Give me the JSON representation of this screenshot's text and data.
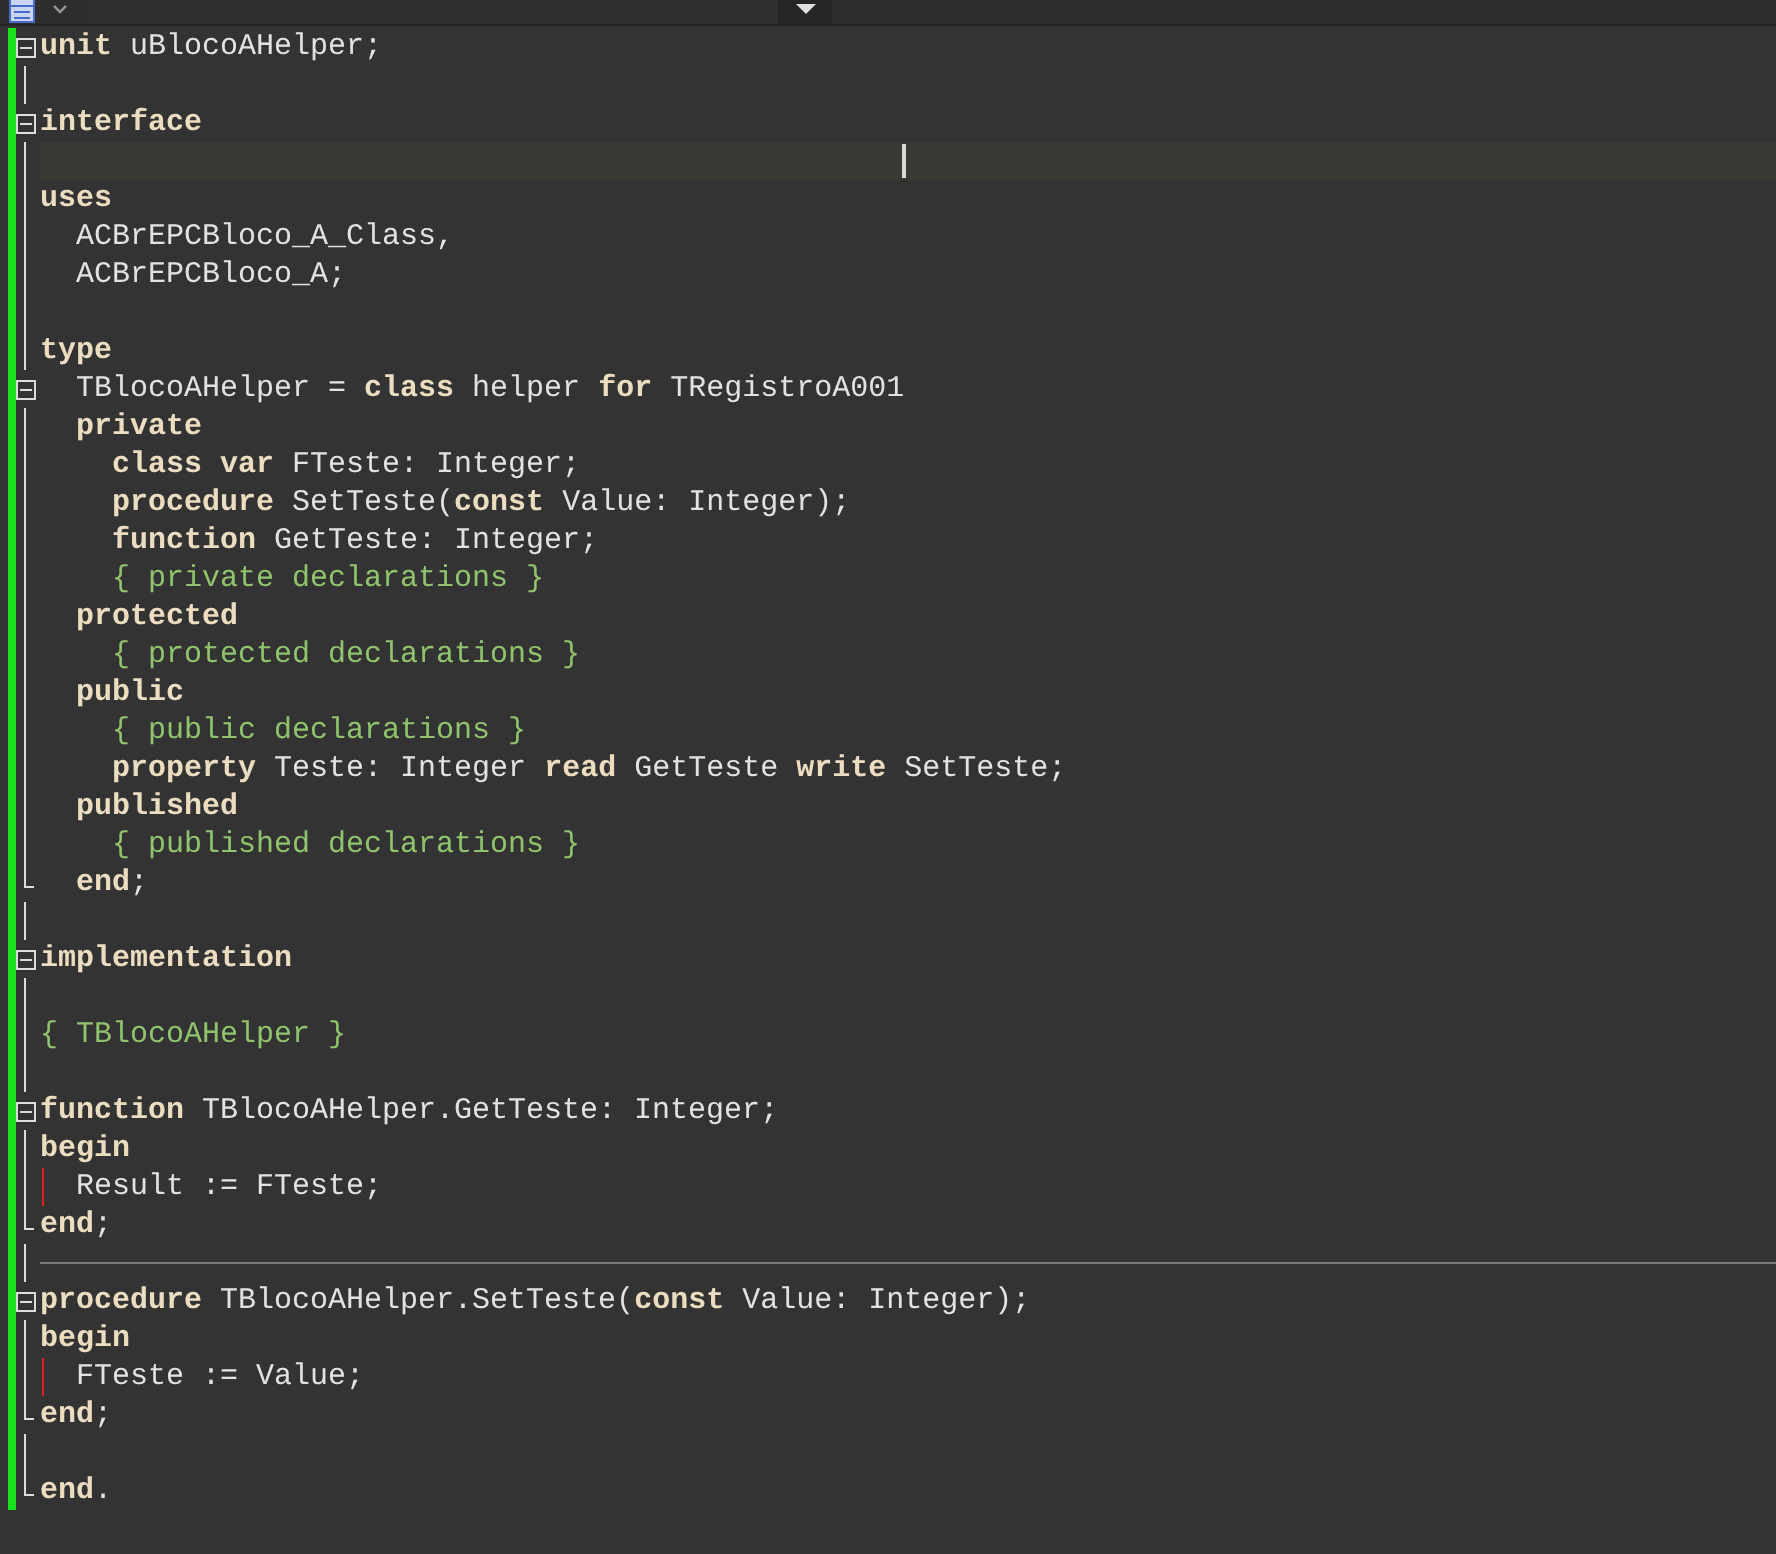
{
  "lines": [
    {
      "kind": "start",
      "current": false,
      "cursor": false,
      "guide": false,
      "separator": false,
      "segments": [
        {
          "kind": "keyword",
          "text": "unit"
        },
        {
          "kind": "plain",
          "text": " uBlocoAHelper;"
        }
      ]
    },
    {
      "kind": "line",
      "current": false,
      "cursor": false,
      "guide": false,
      "separator": false
    },
    {
      "kind": "start",
      "current": false,
      "cursor": false,
      "guide": false,
      "separator": false,
      "segments": [
        {
          "kind": "keyword",
          "text": "interface"
        }
      ]
    },
    {
      "kind": "line",
      "current": true,
      "cursor": true,
      "guide": false,
      "separator": false
    },
    {
      "kind": "line",
      "current": false,
      "cursor": false,
      "guide": false,
      "separator": false,
      "segments": [
        {
          "kind": "keyword",
          "text": "uses"
        }
      ]
    },
    {
      "kind": "line",
      "current": false,
      "cursor": false,
      "guide": false,
      "separator": false,
      "segments": [
        {
          "kind": "plain",
          "text": "  ACBrEPCBloco_A_Class,"
        }
      ]
    },
    {
      "kind": "line",
      "current": false,
      "cursor": false,
      "guide": false,
      "separator": false,
      "segments": [
        {
          "kind": "plain",
          "text": "  ACBrEPCBloco_A;"
        }
      ]
    },
    {
      "kind": "line",
      "current": false,
      "cursor": false,
      "guide": false,
      "separator": false
    },
    {
      "kind": "line",
      "current": false,
      "cursor": false,
      "guide": false,
      "separator": false,
      "segments": [
        {
          "kind": "keyword",
          "text": "type"
        }
      ]
    },
    {
      "kind": "start",
      "current": false,
      "cursor": false,
      "guide": false,
      "separator": false,
      "segments": [
        {
          "kind": "plain",
          "text": "  TBlocoAHelper = "
        },
        {
          "kind": "keyword",
          "text": "class"
        },
        {
          "kind": "plain",
          "text": " helper "
        },
        {
          "kind": "keyword",
          "text": "for"
        },
        {
          "kind": "plain",
          "text": " TRegistroA001"
        }
      ]
    },
    {
      "kind": "line",
      "current": false,
      "cursor": false,
      "guide": false,
      "separator": false,
      "segments": [
        {
          "kind": "keyword",
          "text": "  private"
        }
      ]
    },
    {
      "kind": "line",
      "current": false,
      "cursor": false,
      "guide": false,
      "separator": false,
      "segments": [
        {
          "kind": "keyword",
          "text": "    class var"
        },
        {
          "kind": "plain",
          "text": " FTeste: Integer;"
        }
      ]
    },
    {
      "kind": "line",
      "current": false,
      "cursor": false,
      "guide": false,
      "separator": false,
      "segments": [
        {
          "kind": "keyword",
          "text": "    procedure"
        },
        {
          "kind": "plain",
          "text": " SetTeste("
        },
        {
          "kind": "keyword",
          "text": "const"
        },
        {
          "kind": "plain",
          "text": " Value: Integer);"
        }
      ]
    },
    {
      "kind": "line",
      "current": false,
      "cursor": false,
      "guide": false,
      "separator": false,
      "segments": [
        {
          "kind": "keyword",
          "text": "    function"
        },
        {
          "kind": "plain",
          "text": " GetTeste: Integer;"
        }
      ]
    },
    {
      "kind": "line",
      "current": false,
      "cursor": false,
      "guide": false,
      "separator": false,
      "segments": [
        {
          "kind": "comment",
          "text": "    { private declarations }"
        }
      ]
    },
    {
      "kind": "line",
      "current": false,
      "cursor": false,
      "guide": false,
      "separator": false,
      "segments": [
        {
          "kind": "keyword",
          "text": "  protected"
        }
      ]
    },
    {
      "kind": "line",
      "current": false,
      "cursor": false,
      "guide": false,
      "separator": false,
      "segments": [
        {
          "kind": "comment",
          "text": "    { protected declarations }"
        }
      ]
    },
    {
      "kind": "line",
      "current": false,
      "cursor": false,
      "guide": false,
      "separator": false,
      "segments": [
        {
          "kind": "keyword",
          "text": "  public"
        }
      ]
    },
    {
      "kind": "line",
      "current": false,
      "cursor": false,
      "guide": false,
      "separator": false,
      "segments": [
        {
          "kind": "comment",
          "text": "    { public declarations }"
        }
      ]
    },
    {
      "kind": "line",
      "current": false,
      "cursor": false,
      "guide": false,
      "separator": false,
      "segments": [
        {
          "kind": "keyword",
          "text": "    property"
        },
        {
          "kind": "plain",
          "text": " Teste: Integer "
        },
        {
          "kind": "keyword",
          "text": "read"
        },
        {
          "kind": "plain",
          "text": " GetTeste "
        },
        {
          "kind": "keyword",
          "text": "write"
        },
        {
          "kind": "plain",
          "text": " SetTeste;"
        }
      ]
    },
    {
      "kind": "line",
      "current": false,
      "cursor": false,
      "guide": false,
      "separator": false,
      "segments": [
        {
          "kind": "keyword",
          "text": "  published"
        }
      ]
    },
    {
      "kind": "line",
      "current": false,
      "cursor": false,
      "guide": false,
      "separator": false,
      "segments": [
        {
          "kind": "comment",
          "text": "    { published declarations }"
        }
      ]
    },
    {
      "kind": "end",
      "current": false,
      "cursor": false,
      "guide": false,
      "separator": false,
      "segments": [
        {
          "kind": "keyword",
          "text": "  end"
        },
        {
          "kind": "plain",
          "text": ";"
        }
      ]
    },
    {
      "kind": "line",
      "current": false,
      "cursor": false,
      "guide": false,
      "separator": false
    },
    {
      "kind": "start",
      "current": false,
      "cursor": false,
      "guide": false,
      "separator": false,
      "segments": [
        {
          "kind": "keyword",
          "text": "implementation"
        }
      ]
    },
    {
      "kind": "line",
      "current": false,
      "cursor": false,
      "guide": false,
      "separator": false
    },
    {
      "kind": "line",
      "current": false,
      "cursor": false,
      "guide": false,
      "separator": false,
      "segments": [
        {
          "kind": "comment",
          "text": "{ TBlocoAHelper }"
        }
      ]
    },
    {
      "kind": "line",
      "current": false,
      "cursor": false,
      "guide": false,
      "separator": false
    },
    {
      "kind": "start",
      "current": false,
      "cursor": false,
      "guide": false,
      "separator": false,
      "segments": [
        {
          "kind": "keyword",
          "text": "function"
        },
        {
          "kind": "plain",
          "text": " TBlocoAHelper.GetTeste: Integer;"
        }
      ]
    },
    {
      "kind": "line",
      "current": false,
      "cursor": false,
      "guide": false,
      "separator": false,
      "segments": [
        {
          "kind": "keyword",
          "text": "begin"
        }
      ]
    },
    {
      "kind": "line",
      "current": false,
      "cursor": false,
      "guide": true,
      "separator": false,
      "segments": [
        {
          "kind": "plain",
          "text": "  Result := FTeste;"
        }
      ]
    },
    {
      "kind": "end",
      "current": false,
      "cursor": false,
      "guide": false,
      "separator": false,
      "segments": [
        {
          "kind": "keyword",
          "text": "end"
        },
        {
          "kind": "plain",
          "text": ";"
        }
      ]
    },
    {
      "kind": "line",
      "current": false,
      "cursor": false,
      "guide": false,
      "separator": true
    },
    {
      "kind": "start",
      "current": false,
      "cursor": false,
      "guide": false,
      "separator": false,
      "segments": [
        {
          "kind": "keyword",
          "text": "procedure"
        },
        {
          "kind": "plain",
          "text": " TBlocoAHelper.SetTeste("
        },
        {
          "kind": "keyword",
          "text": "const"
        },
        {
          "kind": "plain",
          "text": " Value: Integer);"
        }
      ]
    },
    {
      "kind": "line",
      "current": false,
      "cursor": false,
      "guide": false,
      "separator": false,
      "segments": [
        {
          "kind": "keyword",
          "text": "begin"
        }
      ]
    },
    {
      "kind": "line",
      "current": false,
      "cursor": false,
      "guide": true,
      "separator": false,
      "segments": [
        {
          "kind": "plain",
          "text": "  FTeste := Value;"
        }
      ]
    },
    {
      "kind": "end",
      "current": false,
      "cursor": false,
      "guide": false,
      "separator": false,
      "segments": [
        {
          "kind": "keyword",
          "text": "end"
        },
        {
          "kind": "plain",
          "text": ";"
        }
      ]
    },
    {
      "kind": "line",
      "current": false,
      "cursor": false,
      "guide": false,
      "separator": false
    },
    {
      "kind": "end",
      "current": false,
      "cursor": false,
      "guide": false,
      "separator": false,
      "segments": [
        {
          "kind": "keyword",
          "text": "end"
        },
        {
          "kind": "plain",
          "text": "."
        }
      ]
    }
  ]
}
